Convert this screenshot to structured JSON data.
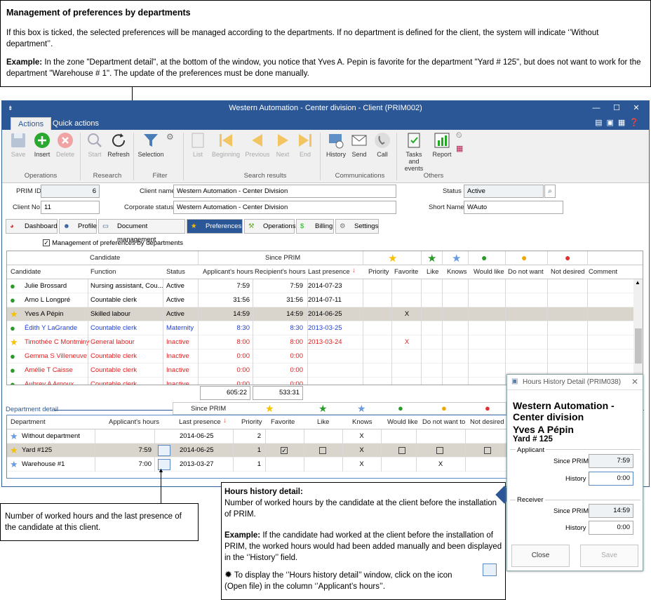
{
  "top_note": {
    "title": "Management of preferences by departments",
    "para1": "If this box is ticked, the selected preferences will be managed according to the departments. If no department is defined for the client, the system will indicate ‘’Without department’’.",
    "example_label": "Example:",
    "example_text": "In the zone \"Department detail\", at the bottom of the window, you notice that Yves A. Pepin is favorite for the department \"Yard # 125\", but does not want to work for the department \"Warehouse # 1\". The update of the preferences must be done manually."
  },
  "window": {
    "title": "Western Automation - Center division - Client (PRIM002)",
    "tabs": [
      "Actions",
      "Quick actions"
    ]
  },
  "ribbon": {
    "buttons": [
      "Save",
      "Insert",
      "Delete",
      "Start",
      "Refresh",
      "Selection",
      "List",
      "Beginning",
      "Previous",
      "Next",
      "End",
      "History",
      "Send",
      "Call",
      "Tasks and events",
      "Report"
    ],
    "groups": [
      "Operations",
      "Research",
      "Filter",
      "Search results",
      "Communications",
      "Others"
    ]
  },
  "form": {
    "prim_id_label": "PRIM ID",
    "prim_id": "6",
    "client_no_label": "Client No.",
    "client_no": "11",
    "client_name_label": "Client name",
    "client_name": "Western Automation - Center Division",
    "corp_status_label": "Corporate status",
    "corp_status": "Western Automation - Center Division",
    "status_label": "Status",
    "status": "Active",
    "short_name_label": "Short Name",
    "short_name": "WAuto"
  },
  "main_tabs": [
    "Dashboard",
    "Profile",
    "Document management",
    "Preferences",
    "Operations",
    "Billing",
    "Settings"
  ],
  "checkbox_label": "Management of preferences by departments",
  "cand_grid": {
    "group_headers": [
      "Candidate",
      "Since PRIM"
    ],
    "columns": [
      "Candidate",
      "Function",
      "Status",
      "Applicant's hours",
      "Recipient's hours",
      "Last presence",
      "Priority",
      "Favorite",
      "Like",
      "Knows",
      "Would like",
      "Do not want",
      "Not desired",
      "Comment"
    ],
    "rows": [
      {
        "name": "Julie Brossard",
        "function": "Nursing assistant, Cou...",
        "status": "Active",
        "app": "7:59",
        "rec": "7:59",
        "last": "2014-07-23",
        "fav": "",
        "color": "#000",
        "icon": "person-green"
      },
      {
        "name": "Arno L Longpré",
        "function": "Countable clerk",
        "status": "Active",
        "app": "31:56",
        "rec": "31:56",
        "last": "2014-07-11",
        "fav": "",
        "color": "#000",
        "icon": "person-green"
      },
      {
        "name": "Yves A Pépin",
        "function": "Skilled labour",
        "status": "Active",
        "app": "14:59",
        "rec": "14:59",
        "last": "2014-06-25",
        "fav": "X",
        "color": "#000",
        "icon": "star"
      },
      {
        "name": "Édith Y LaGrande",
        "function": "Countable clerk",
        "status": "Maternity",
        "app": "8:30",
        "rec": "8:30",
        "last": "2013-03-25",
        "fav": "",
        "color": "#1f3fd0",
        "icon": "person-green"
      },
      {
        "name": "Timothée C Montminy",
        "function": "General labour",
        "status": "Inactive",
        "app": "8:00",
        "rec": "8:00",
        "last": "2013-03-24",
        "fav": "X",
        "color": "#e02020",
        "icon": "star"
      },
      {
        "name": "Gemma S Villeneuve",
        "function": "Countable clerk",
        "status": "Inactive",
        "app": "0:00",
        "rec": "0:00",
        "last": "",
        "fav": "",
        "color": "#e02020",
        "icon": "person-green"
      },
      {
        "name": "Amélie T Caisse",
        "function": "Countable clerk",
        "status": "Inactive",
        "app": "0:00",
        "rec": "0:00",
        "last": "",
        "fav": "",
        "color": "#e02020",
        "icon": "person-green"
      },
      {
        "name": "Aubrey A Arnoux",
        "function": "Countable clerk",
        "status": "Inactive",
        "app": "0:00",
        "rec": "0:00",
        "last": "",
        "fav": "",
        "color": "#e02020",
        "icon": "person-green"
      }
    ],
    "totals": [
      "605:22",
      "533:31"
    ]
  },
  "dept": {
    "label": "Department detail",
    "group_header": "Since PRIM",
    "columns": [
      "Department",
      "Applicant's hours",
      "Last presence",
      "Priority",
      "Favorite",
      "Like",
      "Knows",
      "Would like",
      "Do not want to",
      "Not desired"
    ],
    "rows": [
      {
        "name": "Without department",
        "hours": "",
        "last": "2014-06-25",
        "priority": "2",
        "fav": "",
        "like": "",
        "knows": "X",
        "would": "",
        "dont": "",
        "notdes": "",
        "boxes": false
      },
      {
        "name": "Yard #125",
        "hours": "7:59",
        "last": "2014-06-25",
        "priority": "1",
        "fav": "checked",
        "like": "",
        "knows": "X",
        "would": "",
        "dont": "",
        "notdes": "",
        "boxes": true
      },
      {
        "name": "Warehouse #1",
        "hours": "7:00",
        "last": "2013-03-27",
        "priority": "1",
        "fav": "",
        "like": "",
        "knows": "X",
        "would": "",
        "dont": "X",
        "notdes": "",
        "boxes": false
      }
    ]
  },
  "left_note": "Number of worked hours and the last presence of the candidate at this client.",
  "history_note": {
    "title": "Hours history detail:",
    "line1": "Number of worked hours by the candidate at the client before the installation of PRIM.",
    "example_label": "Example:",
    "example_text": "If the candidate had worked at the client before the installation of PRIM, the worked hours would had been added manually and been displayed in the ‘’History’’ field.",
    "tip1": "To display the ‘’Hours history detail’’ window, click on the icon",
    "tip2": "(Open file) in the column ‘’Applicant’s hours’’."
  },
  "popup": {
    "title": "Hours History Detail (PRIM038)",
    "client": "Western Automation - Center division",
    "person": "Yves A Pépin",
    "dept": "Yard # 125",
    "applicant_label": "Applicant",
    "since_prim": "Since PRIM",
    "app_since": "7:59",
    "history": "History",
    "app_hist": "0:00",
    "receiver_label": "Receiver",
    "rec_since": "14:59",
    "rec_hist": "0:00",
    "close": "Close",
    "save": "Save"
  }
}
